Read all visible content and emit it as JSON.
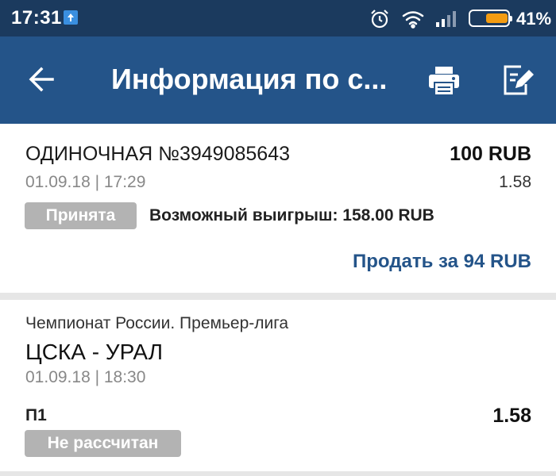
{
  "status_bar": {
    "time": "17:31",
    "battery_percent_text": "41%",
    "battery_level": 0.41,
    "icons": [
      "notification-upload-icon",
      "alarm-icon",
      "wifi-icon",
      "signal-icon",
      "battery-icon"
    ]
  },
  "app_bar": {
    "title": "Информация по с...",
    "icons": [
      "back-arrow-icon",
      "print-icon",
      "edit-icon"
    ]
  },
  "bet": {
    "type": "ОДИНОЧНАЯ №3949085643",
    "amount": "100 RUB",
    "datetime": "01.09.18 | 17:29",
    "odds": "1.58",
    "status": "Принята",
    "possible_win": "Возможный выигрыш: 158.00 RUB",
    "sell_label": "Продать за 94 RUB"
  },
  "event": {
    "league": "Чемпионат России. Премьер-лига",
    "match": "ЦСКА - УРАЛ",
    "datetime": "01.09.18 | 18:30",
    "outcome": "П1",
    "odds": "1.58",
    "status": "Не рассчитан"
  },
  "colors": {
    "status_bar": "#1b3a5e",
    "app_bar": "#245489",
    "link": "#245489",
    "badge": "#b3b3b3",
    "battery_fill": "#f39c12"
  }
}
